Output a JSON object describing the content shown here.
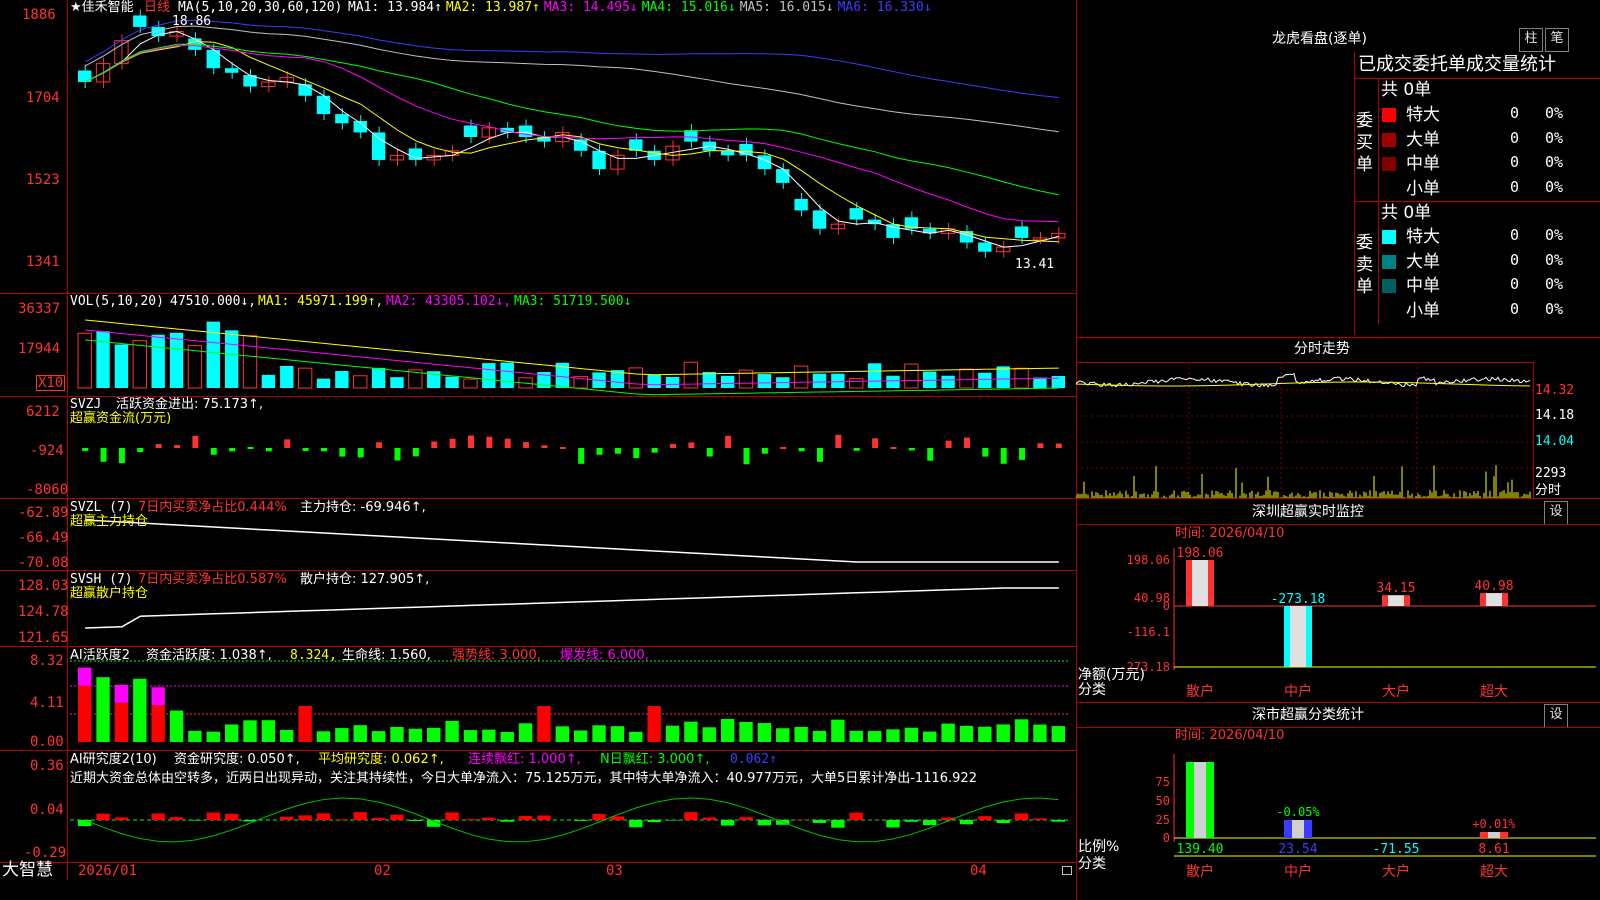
{
  "stock": {
    "name": "★佳禾智能",
    "period": "日线"
  },
  "price_panel": {
    "ma_label": "MA(5,10,20,30,60,120)",
    "ma": [
      {
        "label": "MA1:",
        "value": "13.984",
        "arrow": "↑",
        "color": "#ffffff"
      },
      {
        "label": "MA2:",
        "value": "13.987",
        "arrow": "↑",
        "color": "#ffff00"
      },
      {
        "label": "MA3:",
        "value": "14.495",
        "arrow": "↓",
        "color": "#ff00ff"
      },
      {
        "label": "MA4:",
        "value": "15.016",
        "arrow": "↓",
        "color": "#00ff00"
      },
      {
        "label": "MA5:",
        "value": "16.015",
        "arrow": "↓",
        "color": "#c0c0c0"
      },
      {
        "label": "MA6:",
        "value": "16.330",
        "arrow": "↓",
        "color": "#3c3cff"
      }
    ],
    "y_labels": [
      "1886",
      "1704",
      "1523",
      "1341"
    ],
    "high_mark": "18.86",
    "low_mark": "13.41"
  },
  "vol_panel": {
    "label": "VOL(5,10,20)",
    "value": "47510.000↓,",
    "ma": [
      {
        "text": "MA1: 45971.199↑,",
        "color": "#ffff00"
      },
      {
        "text": "MA2: 43305.102↓,",
        "color": "#ff00ff"
      },
      {
        "text": "MA3: 51719.500↓",
        "color": "#00ff00"
      }
    ],
    "y_labels": [
      "36337",
      "17944"
    ],
    "unit": "X10"
  },
  "svzj_panel": {
    "label": "SVZJ",
    "text1": "活跃资金进出: 75.173↑,",
    "text2": "超赢资金流(万元)",
    "y_labels": [
      "6212",
      "-924",
      "-8060"
    ]
  },
  "svzl_panel": {
    "label": "SVZL (7)",
    "text1": "7日内买卖净占比0.444%",
    "text2": "主力持仓: -69.946↑,",
    "text3": "超赢主力持仓",
    "y_labels": [
      "-62.89",
      "-66.49",
      "-70.08"
    ]
  },
  "svsh_panel": {
    "label": "SVSH (7)",
    "text1": "7日内买卖净占比0.587%",
    "text2": "散户持仓: 127.905↑,",
    "text3": "超赢散户持仓",
    "y_labels": [
      "128.03",
      "124.78",
      "121.65"
    ]
  },
  "ai_active_panel": {
    "label": "AI活跃度2",
    "text1": "资金活跃度: 1.038↑,",
    "text2": "8.324,",
    "text3": "生命线: 1.560,",
    "text4": "强势线: 3.000,",
    "text5": "爆发线: 6.000,",
    "y_labels": [
      "8.32",
      "4.11",
      "0.00"
    ]
  },
  "ai_research_panel": {
    "label": "AI研究度2(10)",
    "text1": "资金研究度: 0.050↑,",
    "text2": "平均研究度: 0.062↑,",
    "text3": "连续飘红: 1.000↑,",
    "text4": "N日飘红: 3.000↑,",
    "text5": "0.062↑",
    "comment": "近期大资金总体由空转多，近两日出现异动，关注其持续性，今日大单净流入：75.125万元，其中特大单净流入：40.977万元，大单5日累计净出-1116.922",
    "y_labels": [
      "0.36",
      "0.04",
      "-0.29"
    ]
  },
  "x_axis": {
    "labels": [
      "2026/01",
      "02",
      "03",
      "04"
    ]
  },
  "bottom_left": "大智慧",
  "longhu": {
    "title": "龙虎看盘(逐单)",
    "btn1": "柱",
    "btn2": "笔",
    "subtitle": "已成交委托单成交量统计",
    "buy_group": {
      "label": "委买单",
      "total": "共 0单",
      "rows": [
        {
          "name": "特大",
          "count": "0",
          "pct": "0%",
          "color": "#ff0000"
        },
        {
          "name": "大单",
          "count": "0",
          "pct": "0%",
          "color": "#a00000"
        },
        {
          "name": "中单",
          "count": "0",
          "pct": "0%",
          "color": "#800000"
        },
        {
          "name": "小单",
          "count": "0",
          "pct": "0%",
          "color": "#000000"
        }
      ]
    },
    "sell_group": {
      "label": "委卖单",
      "total": "共 0单",
      "rows": [
        {
          "name": "特大",
          "count": "0",
          "pct": "0%",
          "color": "#00ffff"
        },
        {
          "name": "大单",
          "count": "0",
          "pct": "0%",
          "color": "#008080"
        },
        {
          "name": "中单",
          "count": "0",
          "pct": "0%",
          "color": "#006060"
        },
        {
          "name": "小单",
          "count": "0",
          "pct": "0%",
          "color": "#000000"
        }
      ]
    }
  },
  "intraday": {
    "title": "分时走势",
    "y_labels": [
      "14.32",
      "14.18",
      "14.04",
      "2293",
      "分时"
    ]
  },
  "sz_monitor": {
    "title": "深圳超赢实时监控",
    "btn": "设",
    "time": "时间: 2026/04/10",
    "y_labels": [
      "198.06",
      "40.98",
      "0",
      "-116.1",
      "-273.18"
    ],
    "unit": "净额(万元)",
    "cat_label": "分类",
    "categories": [
      "散户",
      "中户",
      "大户",
      "超大"
    ],
    "values": [
      "198.06",
      "-273.18",
      "34.15",
      "40.98"
    ]
  },
  "sz_class": {
    "title": "深市超赢分类统计",
    "btn": "设",
    "time": "时间: 2026/04/10",
    "y_labels": [
      "75",
      "50",
      "25",
      "0"
    ],
    "unit": "比例%",
    "cat_label": "分类",
    "categories": [
      "散户",
      "中户",
      "大户",
      "超大"
    ],
    "values": [
      "139.40",
      "23.54",
      "-71.55",
      "8.61"
    ],
    "pcts": [
      "-0.05%",
      "+0.01%"
    ]
  }
}
